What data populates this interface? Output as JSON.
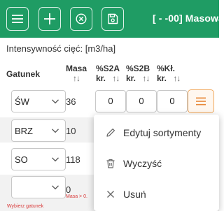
{
  "colors": {
    "toolbar_bg": "#1f9c64",
    "accent_orange": "#f0a75a",
    "warning_red": "#d93a3a"
  },
  "toolbar": {
    "buttons": [
      {
        "icon": "hamburger-menu-icon"
      },
      {
        "icon": "plus-icon"
      },
      {
        "icon": "circle-x-icon"
      },
      {
        "icon": "floppy-save-icon"
      }
    ],
    "title": "[ - -00] Masowa"
  },
  "intensity_label": "Intensywność cięć: [m3/ha]",
  "table": {
    "headers": {
      "species": "Gatunek",
      "masa": "Masa",
      "s2a_top": "%S2A",
      "s2a_bottom": "kr.",
      "s2b_top": "%S2B",
      "s2b_bottom": "kr.",
      "kl_top": "%Kł.",
      "kl_bottom": "kr.",
      "sort_arrows": "↑↓"
    },
    "rows": [
      {
        "species": "ŚW",
        "masa": "36",
        "s2a": "0",
        "s2b": "0",
        "kl": "0"
      },
      {
        "species": "BRZ",
        "masa": "10"
      },
      {
        "species": "SO",
        "masa": "118"
      },
      {
        "species": "",
        "masa": "0",
        "masa_warning": "Masa > 0.",
        "species_warning": "Wybierz gatunek"
      }
    ]
  },
  "row_menu": {
    "items": [
      {
        "label": "Edytuj sortymenty",
        "icon": "pencil-icon"
      },
      {
        "label": "Wyczyść",
        "icon": "trash-icon"
      },
      {
        "label": "Usuń",
        "icon": "close-x-icon"
      }
    ]
  }
}
